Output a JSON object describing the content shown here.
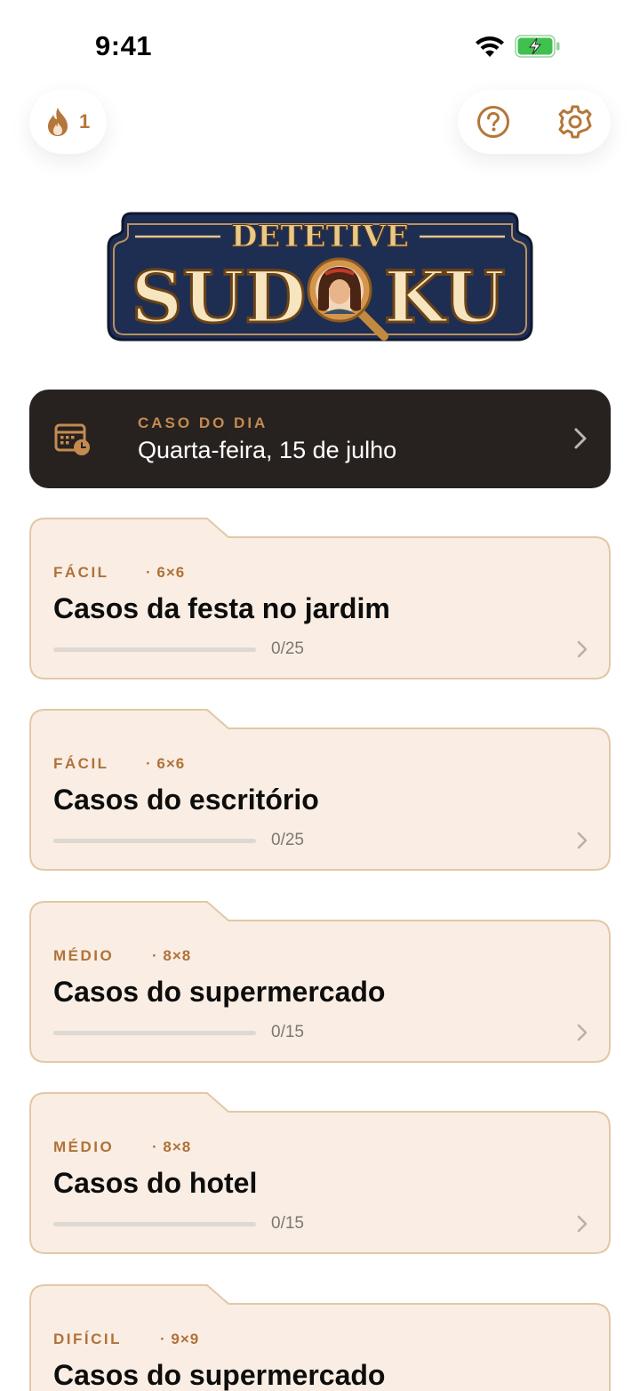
{
  "status": {
    "time": "9:41"
  },
  "streak": {
    "count": "1"
  },
  "logo": {
    "line1": "DETETIVE",
    "line2_left": "SUD",
    "line2_right": "KU"
  },
  "daily": {
    "caption": "CASO DO DIA",
    "date": "Quarta-feira, 15 de julho"
  },
  "cards": [
    {
      "level": "FÁCIL",
      "grid": "· 6×6",
      "title": "Casos da festa no jardim",
      "progress": "0/25",
      "progress_fraction": 0
    },
    {
      "level": "FÁCIL",
      "grid": "· 6×6",
      "title": "Casos do escritório",
      "progress": "0/25",
      "progress_fraction": 0
    },
    {
      "level": "MÉDIO",
      "grid": "· 8×8",
      "title": "Casos do supermercado",
      "progress": "0/15",
      "progress_fraction": 0
    },
    {
      "level": "MÉDIO",
      "grid": "· 8×8",
      "title": "Casos do hotel",
      "progress": "0/15",
      "progress_fraction": 0
    },
    {
      "level": "DIFÍCIL",
      "grid": "· 9×9",
      "title": "Casos do supermercado"
    }
  ],
  "colors": {
    "accent": "#b5763a",
    "card_bg": "#f9ede4",
    "card_border": "#e3c8a8",
    "daily_bg": "#272220"
  },
  "icons": {
    "streak": "flame-icon",
    "help": "question-circle-icon",
    "settings": "gear-icon",
    "calendar": "calendar-clock-icon",
    "chevron": "chevron-right-icon"
  }
}
